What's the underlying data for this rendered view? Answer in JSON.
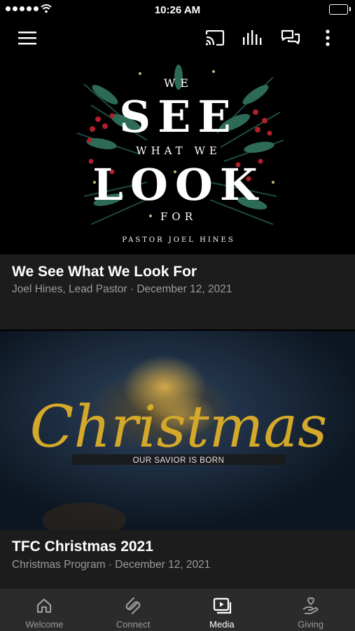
{
  "status_bar": {
    "time": "10:26 AM"
  },
  "app_bar": {
    "icons": [
      "menu-icon",
      "cast-icon",
      "audio-bars-icon",
      "chat-icon",
      "more-vert-icon"
    ]
  },
  "feed": [
    {
      "title": "We See What We Look For",
      "subtitle": "Joel Hines, Lead Pastor · December 12, 2021",
      "artwork_text": {
        "line1": "WE",
        "line2": "SEE",
        "line3": "WHAT WE",
        "line4": "LOOK",
        "line5": "FOR",
        "credit": "PASTOR JOEL HINES"
      }
    },
    {
      "title": "TFC Christmas 2021",
      "subtitle": "Christmas Program · December 12, 2021",
      "artwork_text": {
        "headline": "Christmas",
        "tagline": "OUR SAVIOR IS BORN"
      }
    }
  ],
  "tab_bar": {
    "tabs": [
      {
        "label": "Welcome",
        "icon": "home-icon",
        "active": false
      },
      {
        "label": "Connect",
        "icon": "connect-icon",
        "active": false
      },
      {
        "label": "Media",
        "icon": "media-icon",
        "active": true
      },
      {
        "label": "Giving",
        "icon": "giving-icon",
        "active": false
      }
    ]
  },
  "colors": {
    "background": "#000000",
    "card_info": "#1c1c1c",
    "tab_bar": "#2b2b2b",
    "muted_text": "#9a9a9a",
    "gold": "#d4a82a"
  }
}
